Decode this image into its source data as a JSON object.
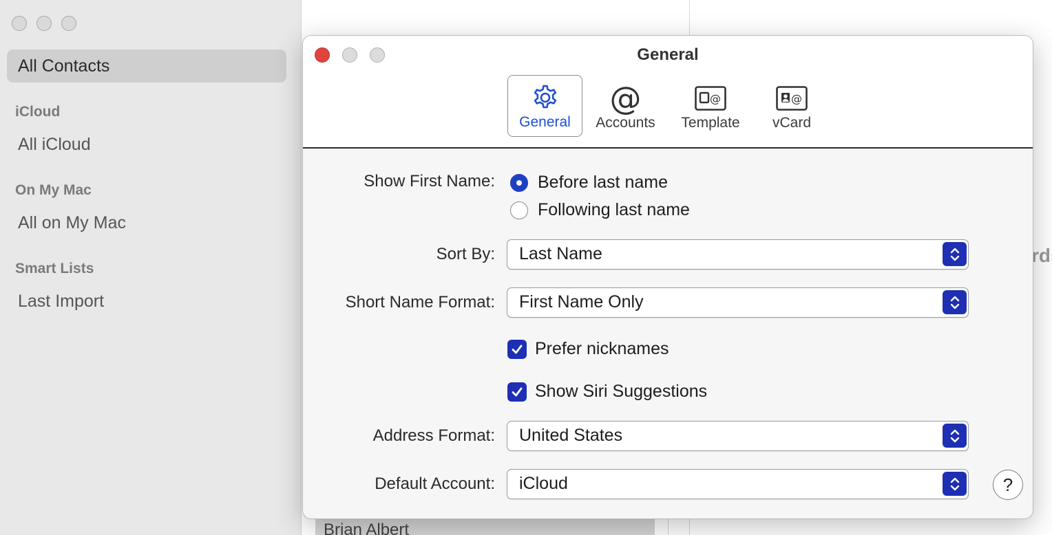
{
  "sidebar": {
    "selected_item": "All Contacts",
    "groups": [
      {
        "header": "iCloud",
        "item": "All iCloud"
      },
      {
        "header": "On My Mac",
        "item": "All on My Mac"
      },
      {
        "header": "Smart Lists",
        "item": "Last Import"
      }
    ]
  },
  "list": {
    "bottom_row": "Brian Albert"
  },
  "detail": {
    "peek_text": "rds"
  },
  "dialog": {
    "title": "General",
    "toolbar": [
      {
        "label": "General",
        "icon": "gear-icon",
        "active": true
      },
      {
        "label": "Accounts",
        "icon": "at-sign-icon",
        "active": false
      },
      {
        "label": "Template",
        "icon": "template-card-icon",
        "active": false
      },
      {
        "label": "vCard",
        "icon": "vcard-icon",
        "active": false
      }
    ],
    "show_first_name": {
      "label": "Show First Name:",
      "options": [
        "Before last name",
        "Following last name"
      ],
      "selected_index": 0
    },
    "sort_by": {
      "label": "Sort By:",
      "value": "Last Name"
    },
    "short_name_format": {
      "label": "Short Name Format:",
      "value": "First Name Only"
    },
    "prefer_nicknames": {
      "label": "Prefer nicknames",
      "checked": true
    },
    "show_siri_suggestions": {
      "label": "Show Siri Suggestions",
      "checked": true
    },
    "address_format": {
      "label": "Address Format:",
      "value": "United States"
    },
    "default_account": {
      "label": "Default Account:",
      "value": "iCloud"
    },
    "help_label": "?"
  },
  "colors": {
    "accent": "#1e2fb3",
    "active_tab_text": "#1f4fcf",
    "close_button": "#e0443e"
  }
}
